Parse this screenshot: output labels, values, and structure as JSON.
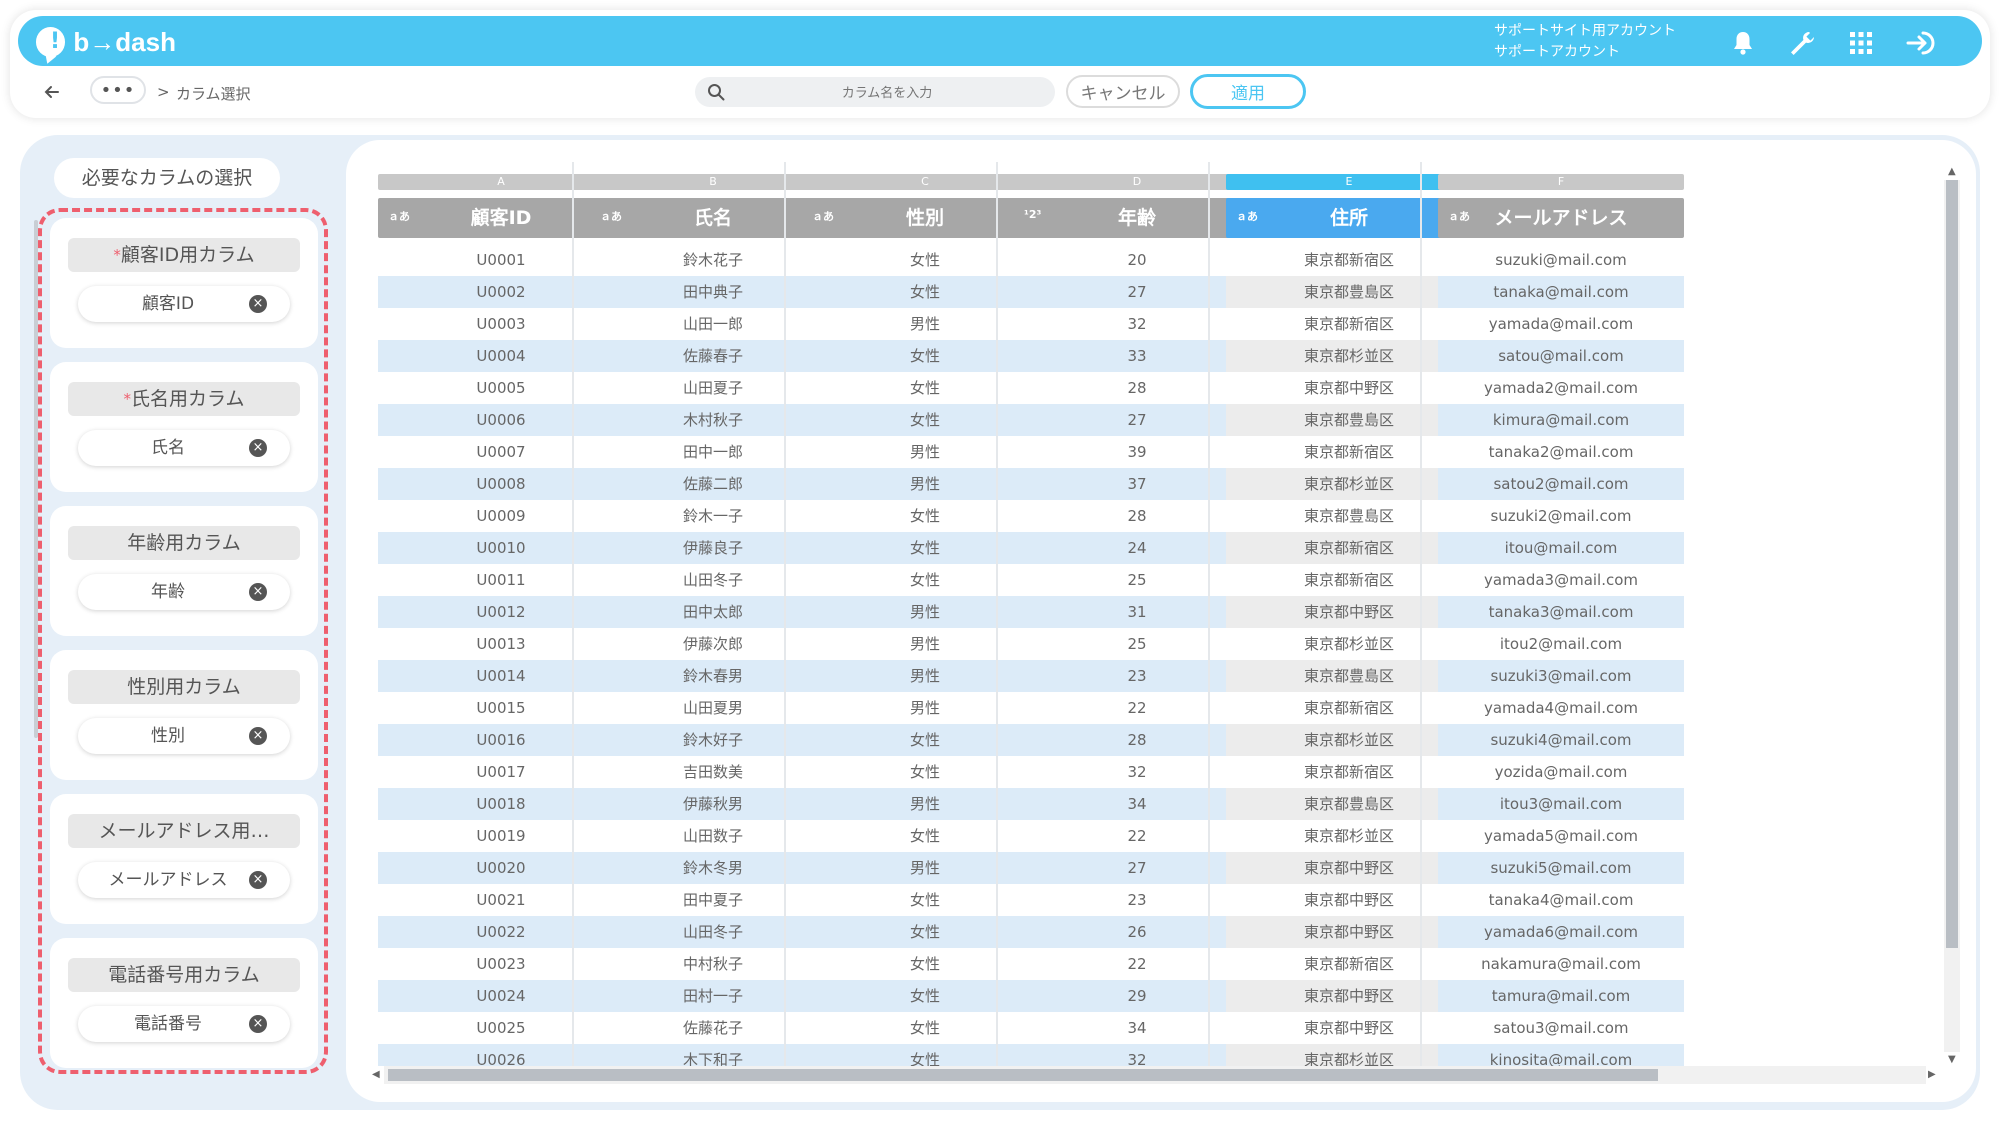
{
  "app": {
    "brand": "b→dash",
    "account_line1": "サポートサイト用アカウント",
    "account_line2": "サポートアカウント"
  },
  "nav": {
    "dots": "•••",
    "separator": ">",
    "current": "カラム選択"
  },
  "search": {
    "placeholder": "カラム名を入力"
  },
  "actions": {
    "cancel": "キャンセル",
    "apply": "適用"
  },
  "left_panel": {
    "title": "必要なカラムの選択",
    "cards": [
      {
        "label": "顧客ID用カラム",
        "required": true,
        "value": "顧客ID"
      },
      {
        "label": "氏名用カラム",
        "required": true,
        "value": "氏名"
      },
      {
        "label": "年齢用カラム",
        "required": false,
        "value": "年齢"
      },
      {
        "label": "性別用カラム",
        "required": false,
        "value": "性別"
      },
      {
        "label": "メールアドレス用…",
        "required": false,
        "value": "メールアドレス"
      },
      {
        "label": "電話番号用カラム",
        "required": false,
        "value": "電話番号"
      }
    ],
    "required_mark": "*",
    "remove_glyph": "×"
  },
  "columns": [
    {
      "letter": "A",
      "type": "ａあ",
      "name": "顧客ID",
      "selected": false,
      "values": [
        "U0001",
        "U0002",
        "U0003",
        "U0004",
        "U0005",
        "U0006",
        "U0007",
        "U0008",
        "U0009",
        "U0010",
        "U0011",
        "U0012",
        "U0013",
        "U0014",
        "U0015",
        "U0016",
        "U0017",
        "U0018",
        "U0019",
        "U0020",
        "U0021",
        "U0022",
        "U0023",
        "U0024",
        "U0025",
        "U0026"
      ]
    },
    {
      "letter": "B",
      "type": "ａあ",
      "name": "氏名",
      "selected": false,
      "values": [
        "鈴木花子",
        "田中典子",
        "山田一郎",
        "佐藤春子",
        "山田夏子",
        "木村秋子",
        "田中一郎",
        "佐藤二郎",
        "鈴木一子",
        "伊藤良子",
        "山田冬子",
        "田中太郎",
        "伊藤次郎",
        "鈴木春男",
        "山田夏男",
        "鈴木好子",
        "吉田数美",
        "伊藤秋男",
        "山田数子",
        "鈴木冬男",
        "田中夏子",
        "山田冬子",
        "中村秋子",
        "田村一子",
        "佐藤花子",
        "木下和子"
      ]
    },
    {
      "letter": "C",
      "type": "ａあ",
      "name": "性別",
      "selected": false,
      "values": [
        "女性",
        "女性",
        "男性",
        "女性",
        "女性",
        "女性",
        "男性",
        "男性",
        "女性",
        "女性",
        "女性",
        "男性",
        "男性",
        "男性",
        "男性",
        "女性",
        "女性",
        "男性",
        "女性",
        "男性",
        "女性",
        "女性",
        "女性",
        "女性",
        "女性",
        "女性"
      ]
    },
    {
      "letter": "D",
      "type": "¹2³",
      "name": "年齢",
      "selected": false,
      "values": [
        "20",
        "27",
        "32",
        "33",
        "28",
        "27",
        "39",
        "37",
        "28",
        "24",
        "25",
        "31",
        "25",
        "23",
        "22",
        "28",
        "32",
        "34",
        "22",
        "27",
        "23",
        "26",
        "22",
        "29",
        "34",
        "32"
      ]
    },
    {
      "letter": "E",
      "type": "ａあ",
      "name": "住所",
      "selected": true,
      "values": [
        "東京都新宿区",
        "東京都豊島区",
        "東京都新宿区",
        "東京都杉並区",
        "東京都中野区",
        "東京都豊島区",
        "東京都新宿区",
        "東京都杉並区",
        "東京都豊島区",
        "東京都新宿区",
        "東京都新宿区",
        "東京都中野区",
        "東京都杉並区",
        "東京都豊島区",
        "東京都新宿区",
        "東京都杉並区",
        "東京都新宿区",
        "東京都豊島区",
        "東京都杉並区",
        "東京都中野区",
        "東京都中野区",
        "東京都中野区",
        "東京都新宿区",
        "東京都中野区",
        "東京都中野区",
        "東京都杉並区"
      ]
    },
    {
      "letter": "F",
      "type": "ａあ",
      "name": "メールアドレス",
      "selected": false,
      "values": [
        "suzuki@mail.com",
        "tanaka@mail.com",
        "yamada@mail.com",
        "satou@mail.com",
        "yamada2@mail.com",
        "kimura@mail.com",
        "tanaka2@mail.com",
        "satou2@mail.com",
        "suzuki2@mail.com",
        "itou@mail.com",
        "yamada3@mail.com",
        "tanaka3@mail.com",
        "itou2@mail.com",
        "suzuki3@mail.com",
        "yamada4@mail.com",
        "suzuki4@mail.com",
        "yozida@mail.com",
        "itou3@mail.com",
        "yamada5@mail.com",
        "suzuki5@mail.com",
        "tanaka4@mail.com",
        "yamada6@mail.com",
        "nakamura@mail.com",
        "tamura@mail.com",
        "satou3@mail.com",
        "kinosita@mail.com"
      ]
    }
  ],
  "icons": {
    "bell": "bell-icon",
    "wrench": "wrench-icon",
    "apps": "grid-icon",
    "logout": "logout-icon",
    "back": "arrow-left-icon",
    "search": "search-icon"
  },
  "colors": {
    "brand": "#4cc6f2",
    "selected_header": "#4aa9ef",
    "header_grey": "#a7a7a7",
    "dashed_border": "#ee5f6e",
    "row_alt": "#dcebf8"
  }
}
